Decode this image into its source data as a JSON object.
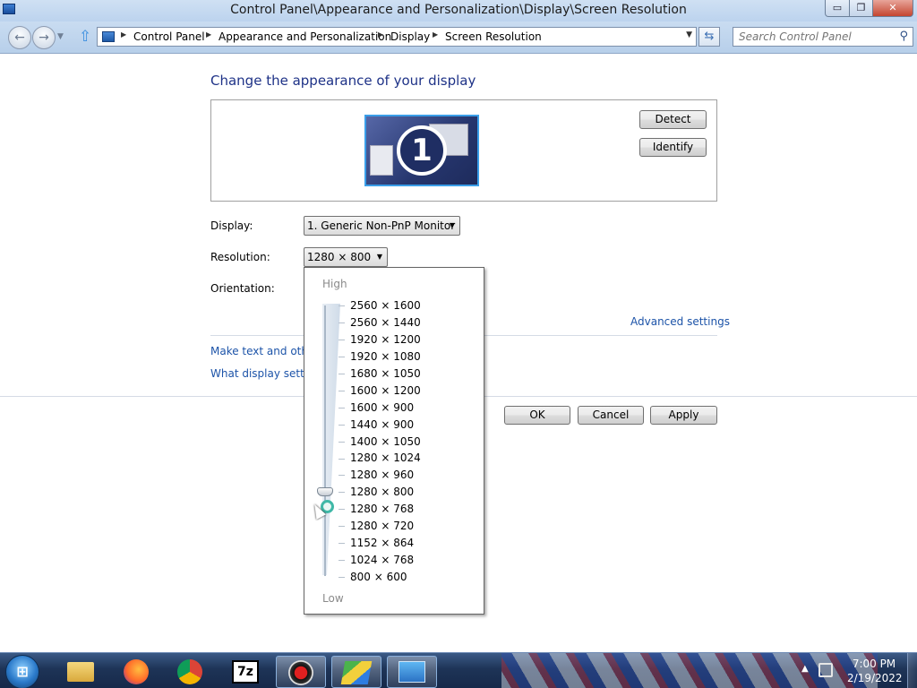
{
  "window": {
    "title": "Control Panel\\Appearance and Personalization\\Display\\Screen Resolution",
    "minimize_glyph": "▭",
    "maximize_glyph": "❐",
    "close_glyph": "✕"
  },
  "nav": {
    "breadcrumb": [
      "Control Panel",
      "Appearance and Personalization",
      "Display",
      "Screen Resolution"
    ],
    "search_placeholder": "Search Control Panel"
  },
  "page": {
    "heading": "Change the appearance of your display",
    "monitor_number": "1",
    "detect_label": "Detect",
    "identify_label": "Identify",
    "display_label": "Display:",
    "display_value": "1. Generic Non-PnP Monitor",
    "resolution_label": "Resolution:",
    "resolution_value": "1280 × 800",
    "orientation_label": "Orientation:",
    "advanced_link": "Advanced settings",
    "link_text_size": "Make text and other",
    "link_display_settings": "What display setting",
    "ok_label": "OK",
    "cancel_label": "Cancel",
    "apply_label": "Apply"
  },
  "dropdown": {
    "high_label": "High",
    "low_label": "Low",
    "options": [
      "2560 × 1600",
      "2560 × 1440",
      "1920 × 1200",
      "1920 × 1080",
      "1680 × 1050",
      "1600 × 1200",
      "1600 × 900",
      "1440 × 900",
      "1400 × 1050",
      "1280 × 1024",
      "1280 × 960",
      "1280 × 800",
      "1280 × 768",
      "1280 × 720",
      "1152 × 864",
      "1024 × 768",
      "800 × 600"
    ],
    "selected": "1280 × 800"
  },
  "taskbar": {
    "start_glyph": "⊞",
    "apps": [
      "Windows Explorer",
      "Firefox",
      "Google Chrome",
      "7-Zip",
      "Screen Recorder",
      "BlueStacks",
      "Control Panel"
    ],
    "seven_zip_label": "7z",
    "tray_arrow": "▲",
    "clock_time": "7:00 PM",
    "clock_date": "2/19/2022"
  },
  "colors": {
    "link": "#1c53a8",
    "heading": "#1e3287",
    "taskbar": "#1e3457"
  }
}
